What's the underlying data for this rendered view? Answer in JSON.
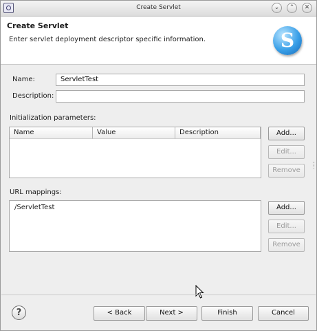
{
  "window": {
    "title": "Create Servlet",
    "controls": [
      "minimize",
      "maximize",
      "close"
    ]
  },
  "header": {
    "title": "Create Servlet",
    "subtitle": "Enter servlet deployment descriptor specific information.",
    "logo_letter": "S"
  },
  "form": {
    "name_label": "Name:",
    "name_value": "ServletTest",
    "description_label": "Description:",
    "description_value": ""
  },
  "init_params": {
    "label": "Initialization parameters:",
    "columns": [
      "Name",
      "Value",
      "Description"
    ],
    "rows": [],
    "add_label": "Add...",
    "edit_label": "Edit...",
    "remove_label": "Remove"
  },
  "url_mappings": {
    "label": "URL mappings:",
    "items": [
      "/ServletTest"
    ],
    "add_label": "Add...",
    "edit_label": "Edit...",
    "remove_label": "Remove"
  },
  "footer": {
    "help_glyph": "?",
    "back_label": "< Back",
    "next_label": "Next >",
    "finish_label": "Finish",
    "cancel_label": "Cancel"
  },
  "colors": {
    "dialog_bg": "#eeeeee",
    "header_bg": "#ffffff",
    "logo_blue": "#3aa0e8",
    "disabled_text": "#9c9c9c"
  }
}
